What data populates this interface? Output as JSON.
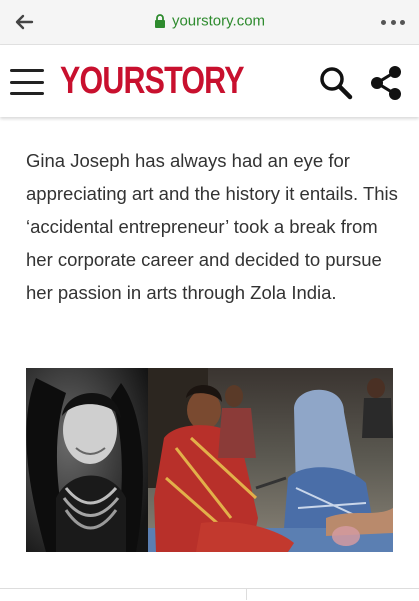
{
  "browser": {
    "url": "yourstory.com",
    "url_color": "#2e8b2e",
    "back_icon": "arrow-left-icon",
    "lock_icon": "lock-icon",
    "more_icon": "more-horizontal-icon"
  },
  "header": {
    "logo": "YOURSTORY",
    "brand_color": "#c8102e",
    "menu_icon": "hamburger-icon",
    "search_icon": "search-icon",
    "share_icon": "share-icon"
  },
  "article": {
    "paragraph": "Gina Joseph has always had an eye for appreciating art and the history it entails. This ‘accidental entrepreneur’ took a break from her corporate career and decided to pursue her passion in arts through Zola India.",
    "image_alt": "Gina Joseph portrait beside women artisans working"
  }
}
